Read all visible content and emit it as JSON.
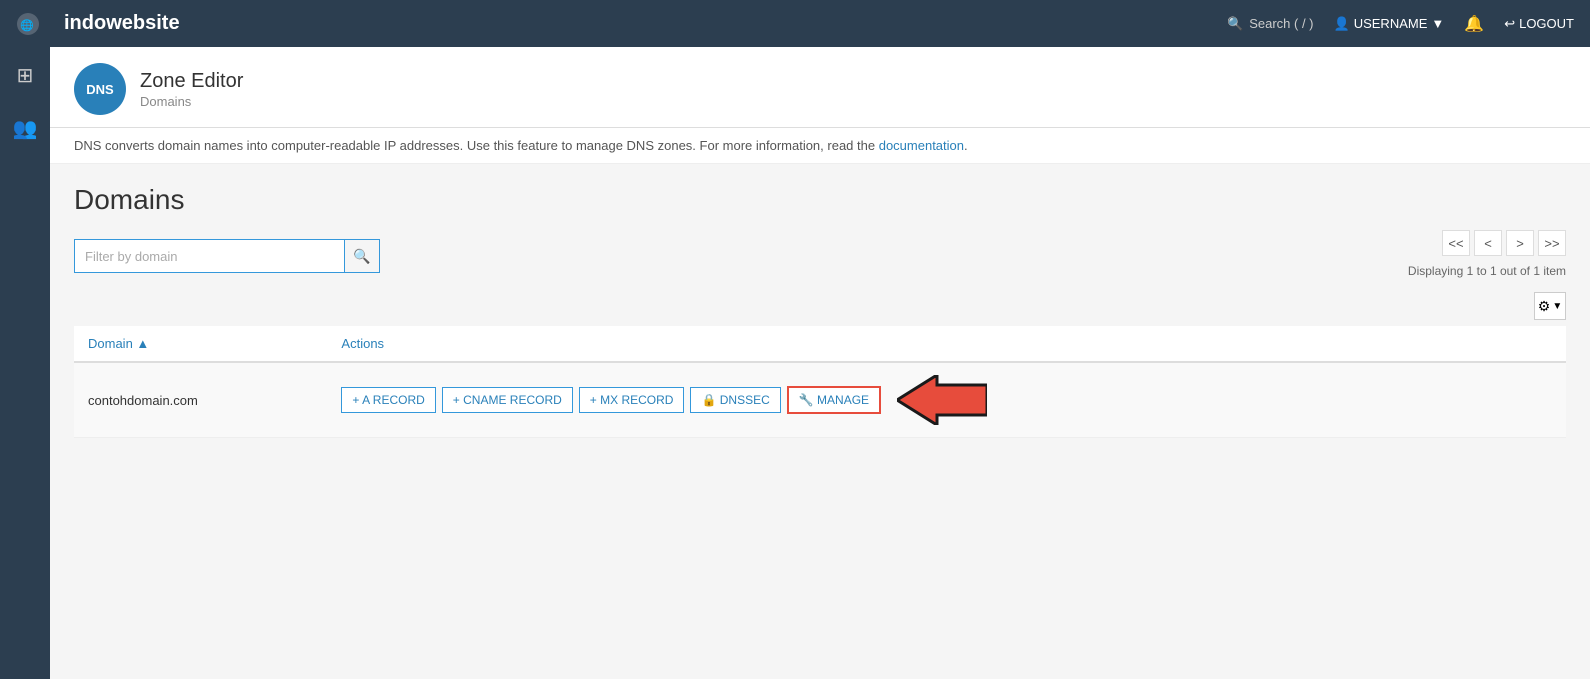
{
  "topnav": {
    "brand": "indowebsite",
    "search_label": "Search ( / )",
    "username": "USERNAME",
    "logout_label": "LOGOUT"
  },
  "sidebar": {
    "items": [
      {
        "name": "grid-icon",
        "icon": "⊞"
      },
      {
        "name": "users-icon",
        "icon": "👥"
      }
    ]
  },
  "page_header": {
    "dns_icon_text": "DNS",
    "title": "Zone Editor",
    "breadcrumb": "Domains"
  },
  "description": {
    "text_before": "DNS converts domain names into computer-readable IP addresses. Use this feature to manage DNS zones. For more information, read the ",
    "link_text": "documentation",
    "text_after": "."
  },
  "domains_section": {
    "title": "Domains",
    "filter_placeholder": "Filter by domain",
    "pagination": {
      "first": "<<",
      "prev": "<",
      "next": ">",
      "last": ">>",
      "info": "Displaying 1 to 1 out of 1 item"
    }
  },
  "table": {
    "columns": [
      {
        "key": "domain",
        "label": "Domain",
        "sortable": true
      },
      {
        "key": "actions",
        "label": "Actions"
      }
    ],
    "rows": [
      {
        "domain": "contohdomain.com",
        "actions": [
          {
            "label": "+ A RECORD",
            "name": "a-record-button"
          },
          {
            "label": "+ CNAME RECORD",
            "name": "cname-record-button"
          },
          {
            "label": "+ MX RECORD",
            "name": "mx-record-button"
          },
          {
            "label": "🔒 DNSSEC",
            "name": "dnssec-button"
          },
          {
            "label": "🔧 MANAGE",
            "name": "manage-button",
            "highlighted": true
          }
        ]
      }
    ]
  }
}
